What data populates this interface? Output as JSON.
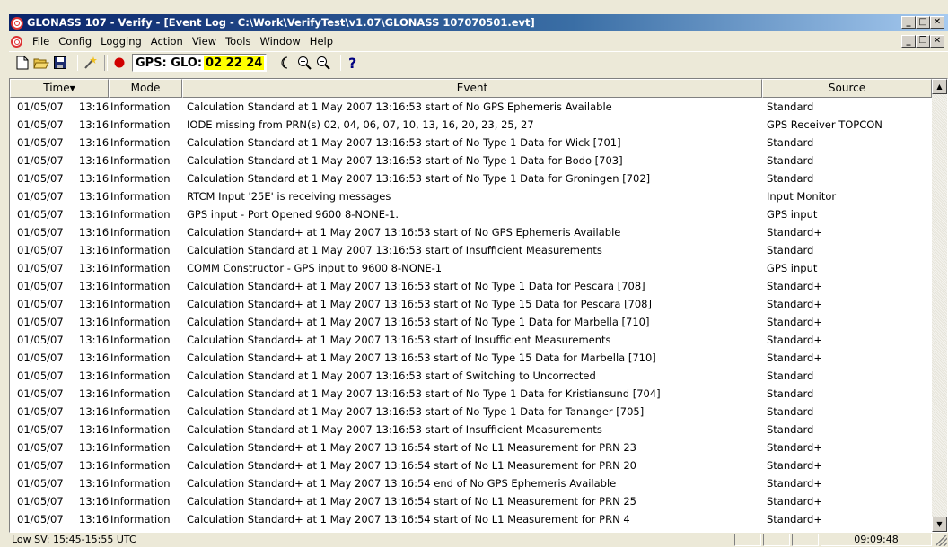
{
  "window": {
    "title": "GLONASS 107 - Verify - [Event Log - C:\\Work\\VerifyTest\\v1.07\\GLONASS 107070501.evt]"
  },
  "menu": [
    "File",
    "Config",
    "Logging",
    "Action",
    "View",
    "Tools",
    "Window",
    "Help"
  ],
  "toolbar": {
    "gps_label": "GPS: GLO:",
    "gps_values": "02 22 24",
    "icons": [
      "new-file-icon",
      "open-folder-icon",
      "save-icon",
      "wand-icon",
      "record-icon",
      "moon-icon",
      "zoom-in-icon",
      "zoom-out-icon",
      "help-icon"
    ]
  },
  "table": {
    "columns": [
      "Time",
      "Mode",
      "Event",
      "Source"
    ],
    "sort_indicator": "▼",
    "rows": [
      {
        "date": "01/05/07",
        "time": "13:16",
        "mode": "Information",
        "event": "Calculation Standard at 1 May 2007 13:16:53 start of No GPS Ephemeris Available",
        "source": "Standard"
      },
      {
        "date": "01/05/07",
        "time": "13:16",
        "mode": "Information",
        "event": "IODE missing from PRN(s) 02, 04, 06, 07, 10, 13, 16, 20, 23, 25, 27",
        "source": "GPS Receiver TOPCON"
      },
      {
        "date": "01/05/07",
        "time": "13:16",
        "mode": "Information",
        "event": "Calculation Standard at 1 May 2007 13:16:53 start of No Type 1 Data for Wick [701]",
        "source": "Standard"
      },
      {
        "date": "01/05/07",
        "time": "13:16",
        "mode": "Information",
        "event": "Calculation Standard at 1 May 2007 13:16:53 start of No Type 1 Data for Bodo [703]",
        "source": "Standard"
      },
      {
        "date": "01/05/07",
        "time": "13:16",
        "mode": "Information",
        "event": "Calculation Standard at 1 May 2007 13:16:53 start of No Type 1 Data for Groningen [702]",
        "source": "Standard"
      },
      {
        "date": "01/05/07",
        "time": "13:16",
        "mode": "Information",
        "event": "RTCM Input '25E' is receiving messages",
        "source": "Input Monitor"
      },
      {
        "date": "01/05/07",
        "time": "13:16",
        "mode": "Information",
        "event": "GPS input - Port Opened 9600 8-NONE-1.",
        "source": "GPS input"
      },
      {
        "date": "01/05/07",
        "time": "13:16",
        "mode": "Information",
        "event": "Calculation Standard+ at 1 May 2007 13:16:53 start of No GPS Ephemeris Available",
        "source": "Standard+"
      },
      {
        "date": "01/05/07",
        "time": "13:16",
        "mode": "Information",
        "event": "Calculation Standard at 1 May 2007 13:16:53 start of Insufficient Measurements",
        "source": "Standard"
      },
      {
        "date": "01/05/07",
        "time": "13:16",
        "mode": "Information",
        "event": "COMM Constructor - GPS input to 9600 8-NONE-1",
        "source": "GPS input"
      },
      {
        "date": "01/05/07",
        "time": "13:16",
        "mode": "Information",
        "event": "Calculation Standard+ at 1 May 2007 13:16:53 start of No Type 1 Data for Pescara [708]",
        "source": "Standard+"
      },
      {
        "date": "01/05/07",
        "time": "13:16",
        "mode": "Information",
        "event": "Calculation Standard+ at 1 May 2007 13:16:53 start of No Type 15 Data for Pescara [708]",
        "source": "Standard+"
      },
      {
        "date": "01/05/07",
        "time": "13:16",
        "mode": "Information",
        "event": "Calculation Standard+ at 1 May 2007 13:16:53 start of No Type 1 Data for Marbella [710]",
        "source": "Standard+"
      },
      {
        "date": "01/05/07",
        "time": "13:16",
        "mode": "Information",
        "event": "Calculation Standard+ at 1 May 2007 13:16:53 start of Insufficient Measurements",
        "source": "Standard+"
      },
      {
        "date": "01/05/07",
        "time": "13:16",
        "mode": "Information",
        "event": "Calculation Standard+ at 1 May 2007 13:16:53 start of No Type 15 Data for Marbella [710]",
        "source": "Standard+"
      },
      {
        "date": "01/05/07",
        "time": "13:16",
        "mode": "Information",
        "event": "Calculation Standard at 1 May 2007 13:16:53 start of Switching to Uncorrected",
        "source": "Standard"
      },
      {
        "date": "01/05/07",
        "time": "13:16",
        "mode": "Information",
        "event": "Calculation Standard at 1 May 2007 13:16:53 start of No Type 1 Data for Kristiansund [704]",
        "source": "Standard"
      },
      {
        "date": "01/05/07",
        "time": "13:16",
        "mode": "Information",
        "event": "Calculation Standard at 1 May 2007 13:16:53 start of No Type 1 Data for Tananger [705]",
        "source": "Standard"
      },
      {
        "date": "01/05/07",
        "time": "13:16",
        "mode": "Information",
        "event": "Calculation Standard at 1 May 2007 13:16:53 start of Insufficient Measurements",
        "source": "Standard"
      },
      {
        "date": "01/05/07",
        "time": "13:16",
        "mode": "Information",
        "event": "Calculation Standard+ at 1 May 2007 13:16:54 start of No L1 Measurement for PRN 23",
        "source": "Standard+"
      },
      {
        "date": "01/05/07",
        "time": "13:16",
        "mode": "Information",
        "event": "Calculation Standard+ at 1 May 2007 13:16:54 start of No L1 Measurement for PRN 20",
        "source": "Standard+"
      },
      {
        "date": "01/05/07",
        "time": "13:16",
        "mode": "Information",
        "event": "Calculation Standard+ at 1 May 2007 13:16:54 end of No GPS Ephemeris Available",
        "source": "Standard+"
      },
      {
        "date": "01/05/07",
        "time": "13:16",
        "mode": "Information",
        "event": "Calculation Standard+ at 1 May 2007 13:16:54 start of No L1 Measurement for PRN 25",
        "source": "Standard+"
      },
      {
        "date": "01/05/07",
        "time": "13:16",
        "mode": "Information",
        "event": "Calculation Standard+ at 1 May 2007 13:16:54 start of No L1 Measurement for PRN 4",
        "source": "Standard+"
      }
    ]
  },
  "status": {
    "left_text": "Low SV: 15:45-15:55 UTC",
    "clock": "09:09:48"
  }
}
